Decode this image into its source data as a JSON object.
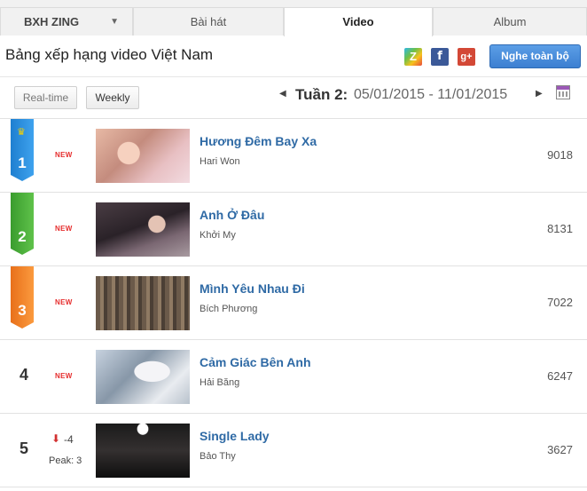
{
  "tabs": {
    "brand": "BXH ZING",
    "items": [
      {
        "label": "Bài hát"
      },
      {
        "label": "Video"
      },
      {
        "label": "Album"
      }
    ],
    "active": "Video"
  },
  "header": {
    "title": "Bảng xếp hạng video Việt Nam",
    "share_icons": [
      "zing-me-icon",
      "facebook-icon",
      "google-plus-icon"
    ],
    "play_all_label": "Nghe toàn bộ"
  },
  "modes": {
    "realtime_label": "Real-time",
    "weekly_label": "Weekly",
    "active": "Weekly"
  },
  "week": {
    "label": "Tuần 2:",
    "range": "05/01/2015 - 11/01/2015"
  },
  "chart": [
    {
      "rank": "1",
      "status": "NEW",
      "title": "Hương Đêm Bay Xa",
      "artist": "Hari Won",
      "views": "9018"
    },
    {
      "rank": "2",
      "status": "NEW",
      "title": "Anh Ở Đâu",
      "artist": "Khởi My",
      "views": "8131"
    },
    {
      "rank": "3",
      "status": "NEW",
      "title": "Mình Yêu Nhau Đi",
      "artist": "Bích Phương",
      "views": "7022"
    },
    {
      "rank": "4",
      "status": "NEW",
      "title": "Cảm Giác Bên Anh",
      "artist": "Hải Băng",
      "views": "6247"
    },
    {
      "rank": "5",
      "change": "-4",
      "peak": "Peak: 3",
      "title": "Single Lady",
      "artist": "Bảo Thy",
      "views": "3627"
    }
  ],
  "colors": {
    "rank1": "#2b8de0",
    "rank2": "#4caf3a",
    "rank3": "#f5852a",
    "title_link": "#2f6aa5",
    "new_badge": "#e62e2e",
    "play_button": "#4a8ddc"
  }
}
